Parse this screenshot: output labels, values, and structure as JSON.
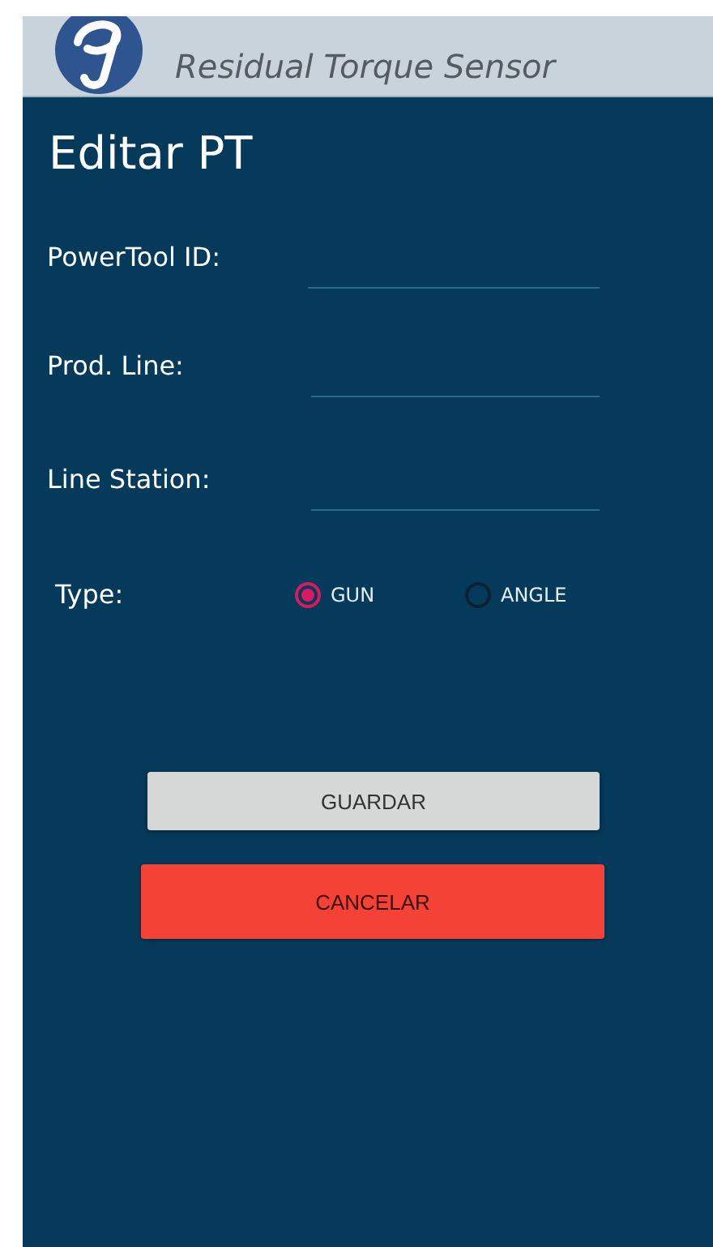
{
  "header": {
    "title": "Residual Torque Sensor"
  },
  "page_title": "Editar PT",
  "fields": [
    {
      "label": "PowerTool ID:"
    },
    {
      "label": "Prod. Line:"
    },
    {
      "label": "Line Station:"
    }
  ],
  "type": {
    "label": "Type:",
    "options": [
      {
        "label": "GUN",
        "selected": true
      },
      {
        "label": "ANGLE",
        "selected": false
      }
    ]
  },
  "buttons": [
    {
      "label": "GUARDAR",
      "kind": "save"
    },
    {
      "label": "CANCELAR",
      "kind": "cancel"
    }
  ]
}
